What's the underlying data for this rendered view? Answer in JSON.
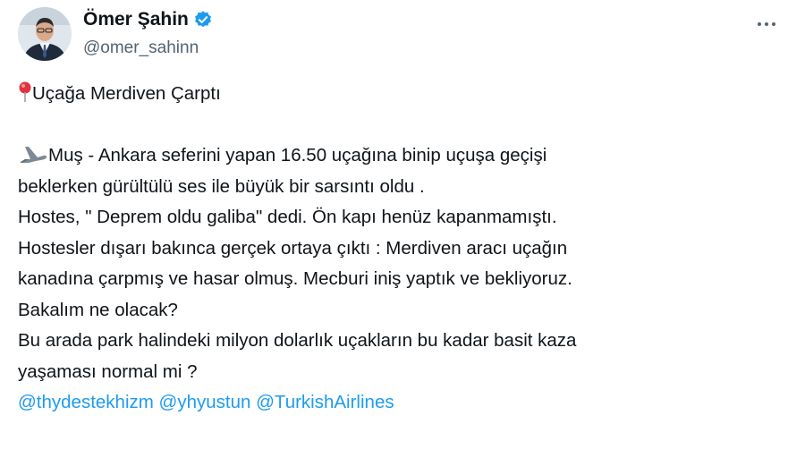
{
  "author": {
    "display_name": "Ömer Şahin",
    "handle": "@omer_sahinn",
    "verified_color": "#1d9bf0"
  },
  "icons": {
    "pin": "round-pushpin-emoji",
    "plane": "airplane-emoji",
    "more": "more-options-icon"
  },
  "tweet": {
    "title": "Uçağa Merdiven Çarptı",
    "lines": [
      "Muş - Ankara seferini yapan 16.50 uçağına binip uçuşa geçişi",
      "beklerken  gürültülü ses ile büyük bir sarsıntı oldu .",
      "Hostes, \" Deprem oldu galiba\" dedi. Ön kapı henüz kapanmamıştı.",
      "Hostesler dışarı bakınca gerçek ortaya çıktı : Merdiven aracı uçağın",
      "kanadına çarpmış  ve hasar olmuş. Mecburi iniş yaptık ve bekliyoruz.",
      "Bakalım ne olacak?",
      "Bu arada park halindeki milyon dolarlık uçakların bu kadar basit kaza",
      "yaşaması normal mi ?"
    ],
    "mentions": [
      "@thydestekhizm",
      "@yhyustun",
      "@TurkishAirlines"
    ]
  }
}
